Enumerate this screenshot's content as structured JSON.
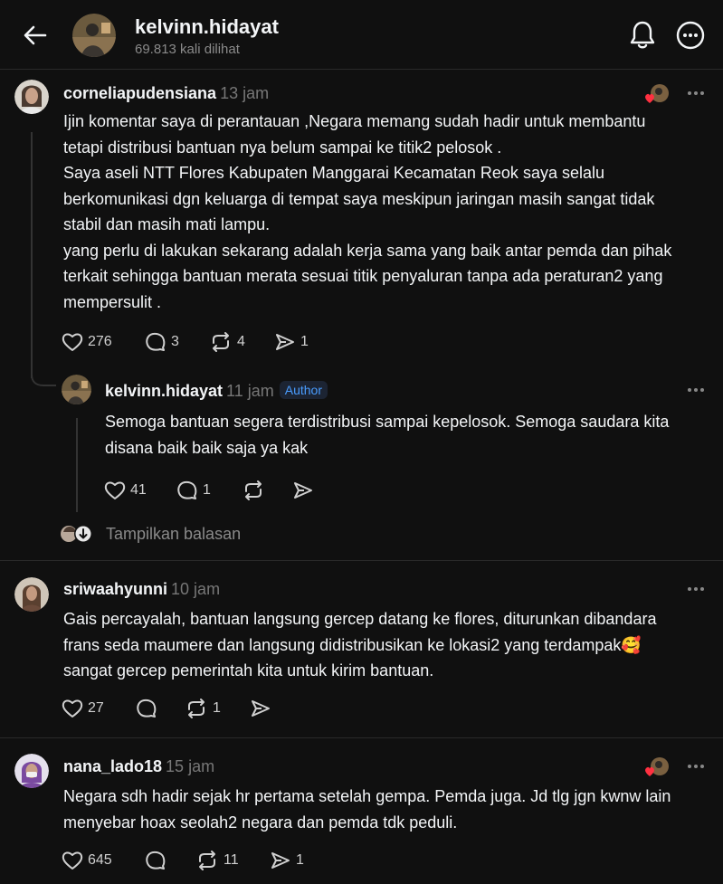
{
  "header": {
    "title": "kelvinn.hidayat",
    "views": "69.813 kali dilihat"
  },
  "comments": [
    {
      "username": "corneliapudensiana",
      "time": "13 jam",
      "text_lines": [
        "Ijin komentar saya di perantauan ,Negara memang sudah hadir untuk membantu",
        "tetapi distribusi bantuan nya belum sampai ke titik2 pelosok .",
        "Saya aseli NTT Flores Kabupaten Manggarai Kecamatan Reok saya selalu",
        "berkomunikasi dgn keluarga di tempat saya meskipun jaringan masih sangat tidak",
        "stabil dan masih mati lampu.",
        "yang perlu di lakukan sekarang adalah kerja sama yang baik antar pemda dan pihak",
        "terkait sehingga bantuan merata sesuai titik penyaluran tanpa ada peraturan2 yang",
        "mempersulit ."
      ],
      "likes": "276",
      "replies": "3",
      "reposts": "4",
      "shares": "1"
    },
    {
      "username": "kelvinn.hidayat",
      "time": "11 jam",
      "badge": "Author",
      "text_lines": [
        "Semoga bantuan segera terdistribusi sampai kepelosok. Semoga saudara kita",
        "disana baik baik saja ya kak"
      ],
      "likes": "41",
      "replies": "1",
      "show_replies": "Tampilkan balasan"
    },
    {
      "username": "sriwaahyunni",
      "time": "10 jam",
      "text_lines": [
        "Gais percayalah, bantuan langsung gercep datang ke flores, diturunkan dibandara",
        "frans seda maumere dan langsung didistribusikan ke lokasi2 yang terdampak🥰",
        "sangat gercep pemerintah kita untuk kirim bantuan."
      ],
      "likes": "27",
      "reposts": "1"
    },
    {
      "username": "nana_lado18",
      "time": "15 jam",
      "text_lines": [
        "Negara sdh hadir sejak hr pertama setelah gempa. Pemda juga. Jd tlg jgn kwnw lain",
        "menyebar hoax seolah2 negara dan pemda tdk peduli."
      ],
      "likes": "645",
      "reposts": "11",
      "shares": "1"
    }
  ],
  "icons": {
    "back": "arrow-left-icon",
    "bell": "bell-icon",
    "more": "more-circle-icon",
    "like": "heart-icon",
    "reply": "comment-icon",
    "repost": "repost-icon",
    "share": "send-icon"
  },
  "colors": {
    "background": "#101010",
    "text": "#f3f5f7",
    "muted": "#777777",
    "badge": "#4a9dff",
    "heart": "#ff3040"
  }
}
